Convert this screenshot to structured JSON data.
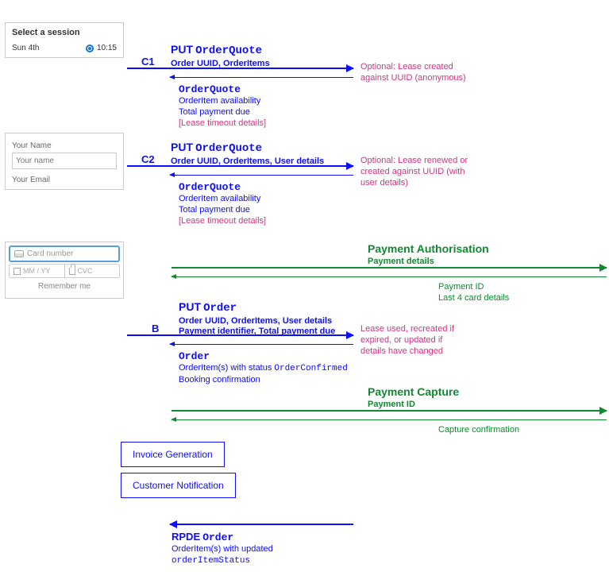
{
  "mock1": {
    "title": "Select a session",
    "day": "Sun 4th",
    "time": "10:15"
  },
  "mock2": {
    "label1": "Your Name",
    "placeholder": "Your name",
    "label2": "Your Email"
  },
  "mock3": {
    "card_placeholder": "Card number",
    "exp_placeholder": "MM / YY",
    "cvc_placeholder": "CVC",
    "remember": "Remember me"
  },
  "labels": {
    "c1": "C1",
    "c2": "C2",
    "b": "B"
  },
  "c1": {
    "req_method": "PUT",
    "req_type": "OrderQuote",
    "req_detail": "Order UUID, OrderItems",
    "note1": "Optional: Lease created",
    "note2": "against UUID (anonymous)",
    "resp_type": "OrderQuote",
    "resp_l1": "OrderItem availability",
    "resp_l2": "Total payment due",
    "resp_l3": "[Lease timeout details]"
  },
  "c2": {
    "req_method": "PUT",
    "req_type": "OrderQuote",
    "req_detail": "Order UUID, OrderItems, User details",
    "note1": "Optional: Lease renewed or",
    "note2": "created against UUID (with",
    "note3": "user details)",
    "resp_type": "OrderQuote",
    "resp_l1": "OrderItem availability",
    "resp_l2": "Total payment due",
    "resp_l3": "[Lease timeout details]"
  },
  "p_auth": {
    "title": "Payment Authorisation",
    "detail": "Payment details",
    "resp1": "Payment ID",
    "resp2": "Last 4 card details"
  },
  "b": {
    "req_method": "PUT",
    "req_type": "Order",
    "req_l1": "Order UUID, OrderItems, User details",
    "req_l2": "Payment identifier, Total payment due",
    "note1": "Lease used, recreated if",
    "note2": "expired, or updated if",
    "note3": "details have changed",
    "resp_type": "Order",
    "resp_l1a": "OrderItem(s) with status",
    "resp_l1b": "OrderConfirmed",
    "resp_l2": "Booking confirmation"
  },
  "p_cap": {
    "title": "Payment Capture",
    "detail": "Payment ID",
    "resp": "Capture confirmation"
  },
  "boxes": {
    "invoice": "Invoice Generation",
    "notify": "Customer Notification"
  },
  "rpde": {
    "l1a": "RPDE",
    "l1b": "Order",
    "l2": "OrderItem(s) with updated",
    "l3": "orderItemStatus"
  }
}
